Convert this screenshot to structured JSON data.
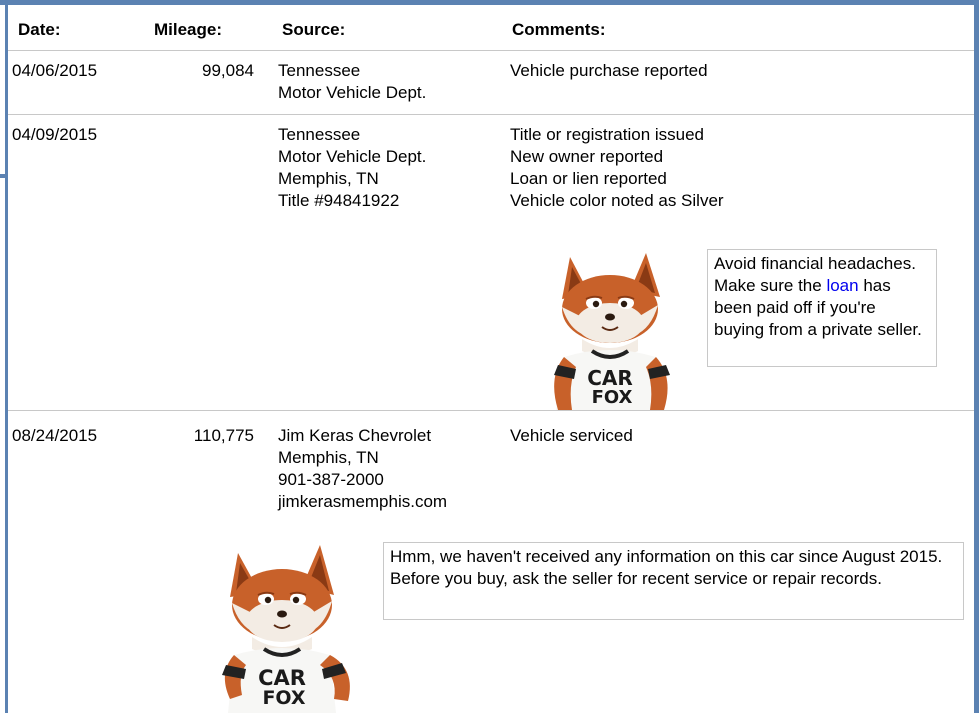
{
  "headers": {
    "date": "Date:",
    "mileage": "Mileage:",
    "source": "Source:",
    "comments": "Comments:"
  },
  "records": [
    {
      "date": "04/06/2015",
      "mileage": "99,084",
      "source": [
        "Tennessee",
        "Motor Vehicle Dept."
      ],
      "comments": [
        "Vehicle purchase reported"
      ]
    },
    {
      "date": "04/09/2015",
      "mileage": "",
      "source": [
        "Tennessee",
        "Motor Vehicle Dept.",
        "Memphis, TN",
        "Title #94841922"
      ],
      "comments": [
        "Title or registration issued",
        "New owner reported",
        "Loan or lien reported",
        "Vehicle color noted as Silver"
      ]
    },
    {
      "date": "08/24/2015",
      "mileage": "110,775",
      "source": [
        "Jim Keras Chevrolet",
        "Memphis, TN",
        "901-387-2000",
        "jimkerasmemphis.com"
      ],
      "comments": [
        "Vehicle serviced"
      ]
    }
  ],
  "tips": {
    "loan": {
      "before": "Avoid financial headaches. Make sure the ",
      "link": "loan",
      "after": " has been paid off if you're buying from a private seller."
    },
    "service": {
      "text": "Hmm, we haven't received any information on this car since August 2015. Before you buy, ask the seller for recent service or repair records."
    }
  },
  "mascot": {
    "shirt_line1": "CAR",
    "shirt_line2": "FOX"
  },
  "colors": {
    "frame": "#5b82b2",
    "divider": "#c8c8c8",
    "link": "#0000ee",
    "fox_fur": "#c8612a",
    "fox_dark": "#8a3a14"
  }
}
